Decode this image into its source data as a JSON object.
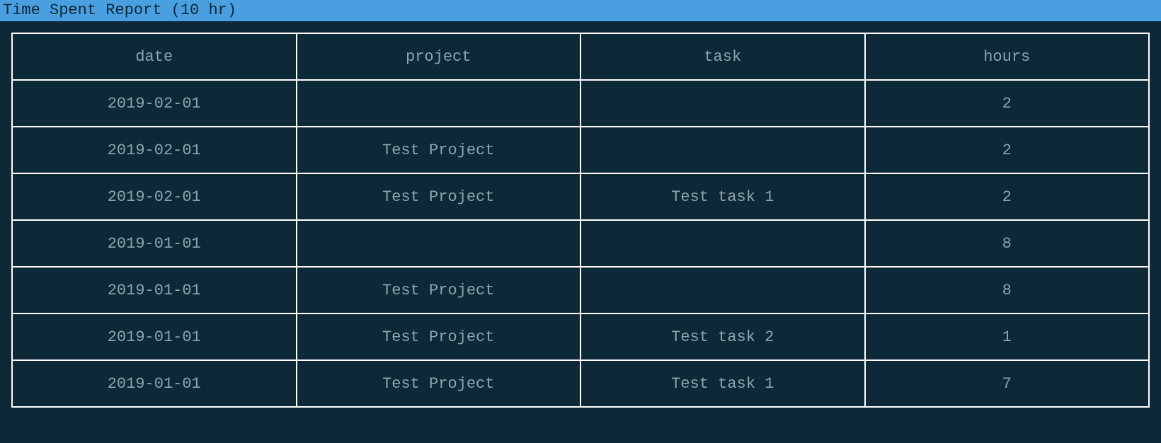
{
  "title": "Time Spent Report (10 hr)",
  "columns": [
    "date",
    "project",
    "task",
    "hours"
  ],
  "rows": [
    {
      "date": "2019-02-01",
      "project": "",
      "task": "",
      "hours": "2"
    },
    {
      "date": "2019-02-01",
      "project": "Test Project",
      "task": "",
      "hours": "2"
    },
    {
      "date": "2019-02-01",
      "project": "Test Project",
      "task": "Test task 1",
      "hours": "2"
    },
    {
      "date": "2019-01-01",
      "project": "",
      "task": "",
      "hours": "8"
    },
    {
      "date": "2019-01-01",
      "project": "Test Project",
      "task": "",
      "hours": "8"
    },
    {
      "date": "2019-01-01",
      "project": "Test Project",
      "task": "Test task 2",
      "hours": "1"
    },
    {
      "date": "2019-01-01",
      "project": "Test Project",
      "task": "Test task 1",
      "hours": "7"
    }
  ]
}
